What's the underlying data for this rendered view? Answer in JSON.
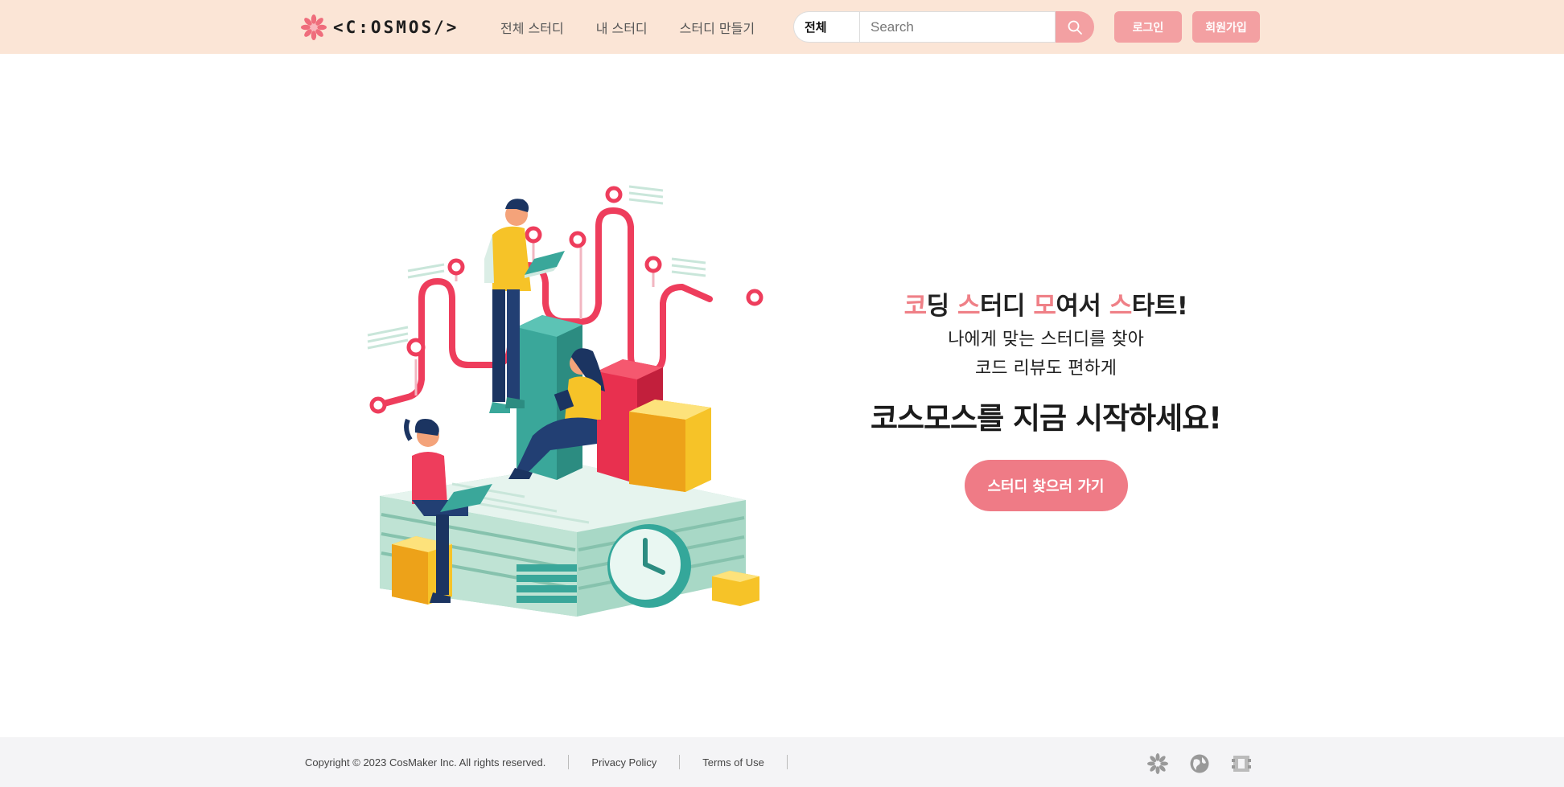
{
  "header": {
    "logo_text": "<C:OSMOS/>",
    "nav": [
      "전체 스터디",
      "내 스터디",
      "스터디 만들기"
    ],
    "search": {
      "category": "전체",
      "placeholder": "Search"
    },
    "login_label": "로그인",
    "signup_label": "회원가입"
  },
  "hero": {
    "tagline": [
      {
        "hl": "코",
        "rest": "딩 "
      },
      {
        "hl": "스",
        "rest": "터디 "
      },
      {
        "hl": "모",
        "rest": "여서 "
      },
      {
        "hl": "스",
        "rest": "타트!"
      }
    ],
    "sub1": "나에게 맞는 스터디를 찾아",
    "sub2": "코드 리뷰도 편하게",
    "headline": "코스모스를 지금 시작하세요!",
    "cta_label": "스터디 찾으러 가기"
  },
  "footer": {
    "copyright": "Copyright © 2023 CosMaker Inc. All rights reserved.",
    "privacy": "Privacy Policy",
    "terms": "Terms of Use",
    "icons": [
      "flower-icon",
      "globe-icon",
      "gear-icon"
    ]
  },
  "colors": {
    "header_bg": "#fbe5d6",
    "accent": "#f3a0a2",
    "cta": "#ef7b86",
    "highlight": "#ef8087",
    "footer_bg": "#f4f4f6"
  }
}
